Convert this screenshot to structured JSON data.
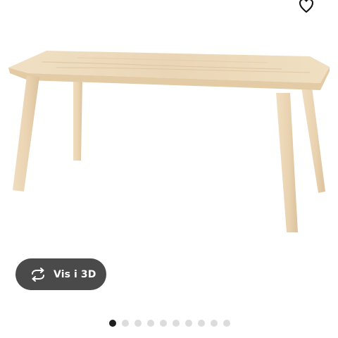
{
  "header": {
    "favorite_icon": "heart-outline-icon"
  },
  "product": {
    "image_subject": "table-image"
  },
  "view_3d": {
    "label": "Vis i 3D",
    "icon": "rotate-arrows-icon"
  },
  "carousel": {
    "total": 10,
    "active_index": 0
  },
  "colors": {
    "button_bg": "#4a4a4a",
    "dot_active": "#1f1f1f",
    "dot_inactive": "#dcdcdc"
  }
}
